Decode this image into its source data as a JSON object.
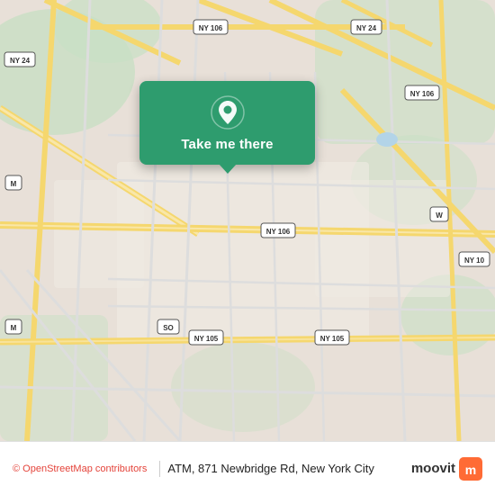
{
  "map": {
    "attribution": "© OpenStreetMap contributors",
    "background_color": "#e8e0d8"
  },
  "popup": {
    "button_label": "Take me there",
    "pin_icon": "location-pin"
  },
  "bottom_bar": {
    "osm_text": "OpenStreetMap contributors",
    "location_label": "ATM, 871 Newbridge Rd, New York City",
    "moovit_label": "moovit"
  },
  "road_labels": [
    {
      "id": "ny106_top",
      "text": "NY 106"
    },
    {
      "id": "ny24_top_left",
      "text": "NY 24"
    },
    {
      "id": "ny24_top_right",
      "text": "NY 24"
    },
    {
      "id": "ny106_mid",
      "text": "NY 106"
    },
    {
      "id": "ny106_right",
      "text": "NY 106"
    },
    {
      "id": "ny105_left",
      "text": "NY 105"
    },
    {
      "id": "ny105_right",
      "text": "NY 105"
    },
    {
      "id": "ny10_right",
      "text": "NY 10"
    },
    {
      "id": "so_label",
      "text": "SO"
    },
    {
      "id": "m_label1",
      "text": "M"
    },
    {
      "id": "m_label2",
      "text": "M"
    },
    {
      "id": "w_label",
      "text": "W"
    }
  ],
  "colors": {
    "popup_bg": "#2e9c6e",
    "popup_text": "#ffffff",
    "map_bg": "#e8e0d8",
    "road_yellow": "#f5d76e",
    "road_white": "#ffffff",
    "green_area": "#c8dfc4",
    "water": "#b3d4e8"
  }
}
